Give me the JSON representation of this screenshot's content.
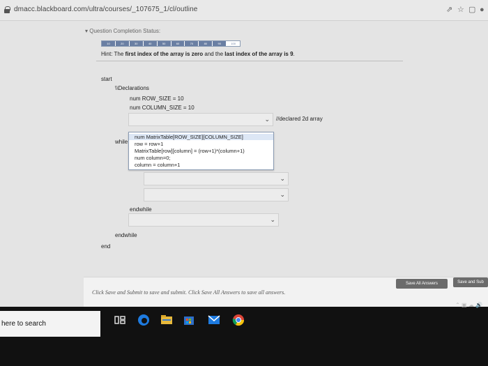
{
  "browser": {
    "url": "dmacc.blackboard.com/ultra/courses/_107675_1/cl/outline",
    "icons": [
      "lock-icon",
      "share-icon",
      "star-icon",
      "tab-icon",
      "profile-icon"
    ]
  },
  "question": {
    "completion_status": "Question Completion Status:",
    "progress_labels": [
      "10",
      "20",
      "30",
      "40",
      "50",
      "60",
      "70",
      "80",
      "90",
      "100"
    ],
    "hint_prefix": "Hint: The ",
    "hint_bold1": "first index of the array is zero",
    "hint_mid": " and the ",
    "hint_bold2": "last index of the array is 9",
    "hint_suffix": "."
  },
  "code": {
    "start": "start",
    "declarations": "\\\\Declarations",
    "row_size": "num ROW_SIZE = 10",
    "column_size": "num COLUMN_SIZE = 10",
    "declared_comment": "//declared 2d array",
    "while1": "while",
    "endwhile_inner": "endwhile",
    "endwhile_outer": "endwhile",
    "end": "end"
  },
  "dropdown": {
    "options": [
      "num MatrixTable[ROW_SIZE][COLUMN_SIZE]",
      "row = row+1",
      "MatrixTable[row][column] = (row+1)*(column+1)",
      "num column=0;",
      "column = column+1"
    ]
  },
  "footer": {
    "submit_text": "Click Save and Submit to save and submit. Click Save All Answers to save all answers.",
    "save_all": "Save All Answers",
    "save_submit": "Save and Sub"
  },
  "taskbar": {
    "search_text": "here to search",
    "apps": [
      "task-view-icon",
      "edge-icon",
      "file-explorer-icon",
      "store-icon",
      "mail-icon",
      "chrome-icon"
    ]
  }
}
